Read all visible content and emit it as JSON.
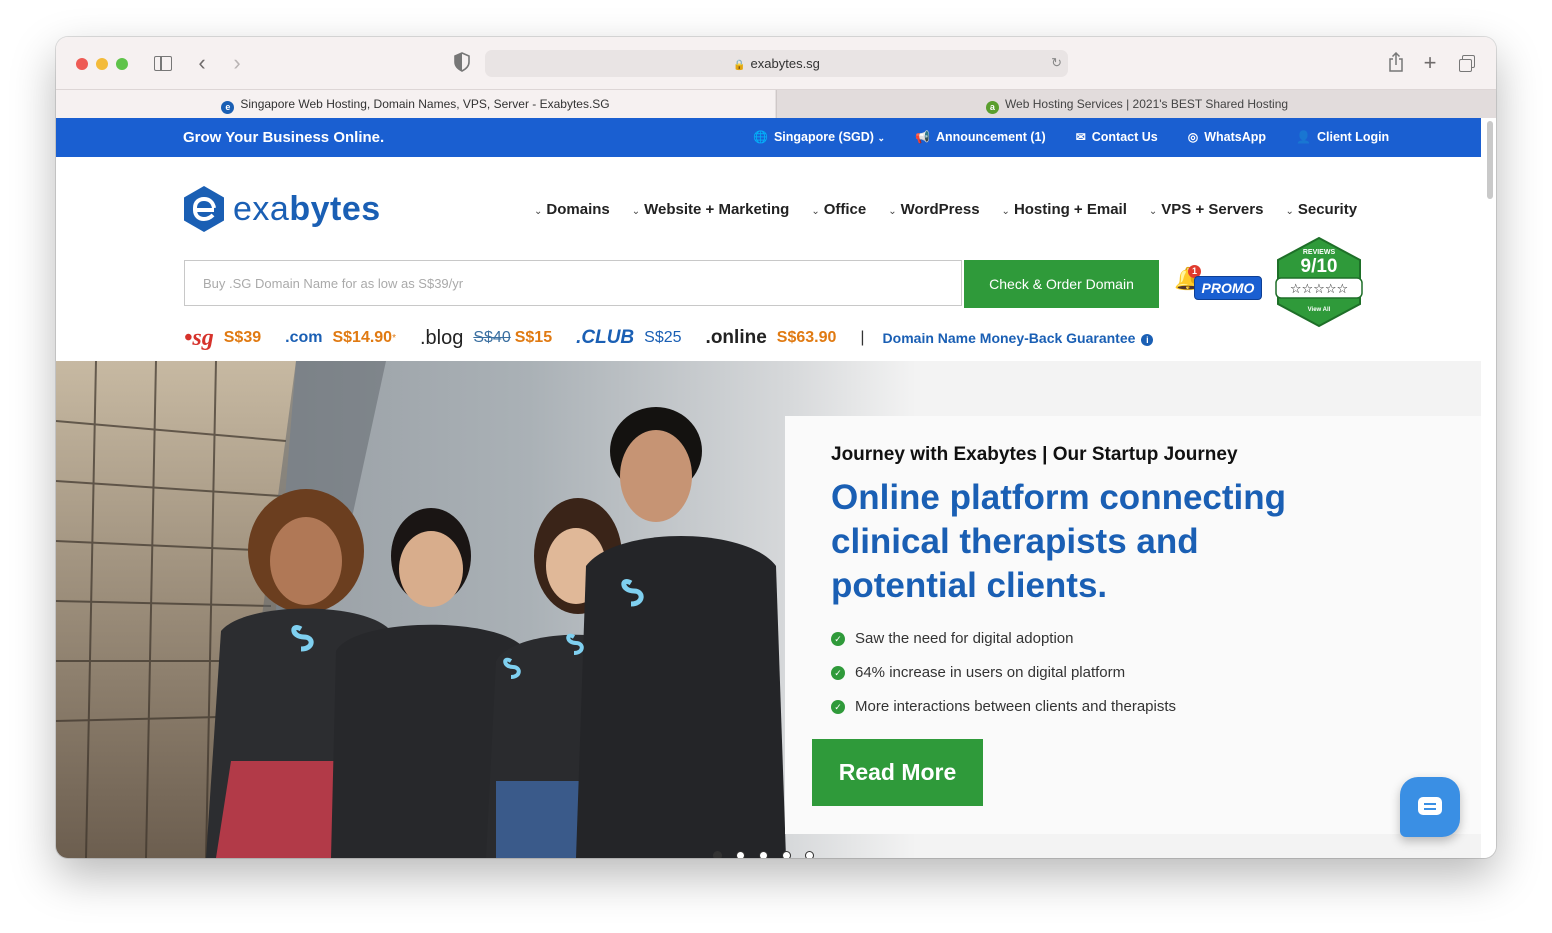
{
  "browser": {
    "url": "exabytes.sg",
    "tabs": [
      {
        "title": "Singapore Web Hosting, Domain Names, VPS, Server - Exabytes.SG",
        "active": true
      },
      {
        "title": "Web Hosting Services | 2021's BEST Shared Hosting",
        "active": false
      }
    ]
  },
  "topbar": {
    "tagline": "Grow Your Business Online.",
    "links": [
      {
        "icon": "globe-icon",
        "label": "Singapore (SGD)"
      },
      {
        "icon": "megaphone-icon",
        "label": "Announcement (1)"
      },
      {
        "icon": "envelope-icon",
        "label": "Contact Us"
      },
      {
        "icon": "whatsapp-icon",
        "label": "WhatsApp"
      },
      {
        "icon": "user-icon",
        "label": "Client Login"
      }
    ]
  },
  "logo": {
    "text_light": "exa",
    "text_bold": "bytes"
  },
  "nav": {
    "items": [
      "Domains",
      "Website + Marketing",
      "Office",
      "WordPress",
      "Hosting + Email",
      "VPS + Servers",
      "Security"
    ]
  },
  "domain_search": {
    "placeholder": "Buy .SG Domain Name for as low as S$39/yr",
    "button": "Check & Order Domain"
  },
  "promo": {
    "label": "PROMO",
    "badge": "1"
  },
  "reviews": {
    "title": "REVIEWS",
    "score": "9/10",
    "link": "View All"
  },
  "prices": {
    "sg": {
      "tld": "sg",
      "price": "S$39"
    },
    "com": {
      "tld": ".com",
      "price": "S$14.90",
      "note": "*"
    },
    "blog": {
      "tld": ".blog",
      "old_price": "S$40",
      "price": "S$15"
    },
    "club": {
      "tld": ".CLUB",
      "price": "S$25"
    },
    "online": {
      "tld": ".online",
      "price": "S$63.90"
    },
    "separator": "|",
    "guarantee": "Domain Name Money-Back Guarantee"
  },
  "hero": {
    "kicker": "Journey with Exabytes | Our Startup Journey",
    "headline": "Online platform connecting clinical therapists and potential clients.",
    "bullets": [
      "Saw the need for digital adoption",
      "64% increase in users on digital platform",
      "More interactions between clients and therapists"
    ],
    "cta": "Read More",
    "slides": 5,
    "active_slide": 1
  },
  "colors": {
    "brand_blue": "#1a5fd1",
    "logo_blue": "#1a5fb4",
    "cta_green": "#2f9a3a",
    "price_orange": "#e07a12"
  }
}
